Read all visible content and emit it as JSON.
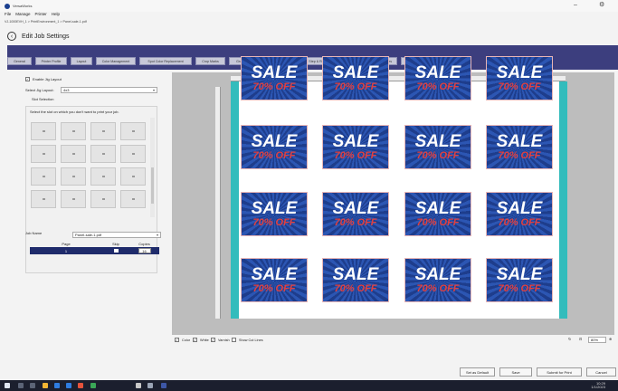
{
  "window": {
    "title": "VersaWorks",
    "min_glyph": "–",
    "settings_glyph": "⚙"
  },
  "menu": [
    "File",
    "Manage",
    "Printer",
    "Help"
  ],
  "breadcrumb": "VJ-1000EVH_1 > PrintEnvironment_1 > Panel-sale-1.pdf",
  "header": {
    "back_glyph": "‹",
    "title": "Edit Job Settings"
  },
  "tabs": [
    {
      "label": "General",
      "active": false
    },
    {
      "label": "Printer Profile",
      "active": false
    },
    {
      "label": "Layout",
      "active": false
    },
    {
      "label": "Color Management",
      "active": false
    },
    {
      "label": "Spot Color Replacement",
      "active": false
    },
    {
      "label": "Crop Marks",
      "active": false
    },
    {
      "label": "Grommets",
      "active": false
    },
    {
      "label": "Tiling & Clipping",
      "active": false
    },
    {
      "label": "Step & Repeat",
      "active": false
    },
    {
      "label": "Jig Layout",
      "active": true
    },
    {
      "label": "Print Modes",
      "active": false
    },
    {
      "label": "Summary",
      "active": false
    }
  ],
  "jig": {
    "enable_label": "Enable Jig Layout",
    "enabled": true,
    "select_label": "Select Jig Layout:",
    "select_value": "4x3",
    "slot_heading": "Slot Selection",
    "slot_help": "Select the slot on which you don't want to print your job.",
    "slot_rows": 4,
    "slot_cols": 4,
    "legend_unavailable": "Unavailable Slots",
    "legend_available": "Available Slots",
    "colors": {
      "unavailable": "#d93025",
      "available": "#bfbfbf"
    }
  },
  "job": {
    "name_label": "Job Name",
    "name_value": "Panel-sale-1.pdf",
    "columns": [
      "Page",
      "Skip",
      "Copies"
    ],
    "rows": [
      {
        "page": "1",
        "skip": false,
        "copies": "16"
      }
    ]
  },
  "artwork": {
    "headline": "SALE",
    "subline": "70% OFF",
    "rows": 4,
    "cols": 4,
    "colors": {
      "background": "#1e3d8c",
      "headline": "#ffffff",
      "subline": "#e2403f",
      "jig_edge": "#33bcbc"
    }
  },
  "options": {
    "color": "Color",
    "white": "White",
    "varnish": "Varnish",
    "cut_lines": "Show Cut Lines"
  },
  "zoom": {
    "value": "80%",
    "refresh_glyph": "↻",
    "fit_glyph": "⊡",
    "zoom_glyph": "⊕"
  },
  "buttons": {
    "set_default": "Set as Default",
    "save": "Save",
    "submit": "Submit for Print",
    "cancel": "Cancel"
  },
  "taskbar": {
    "time": "10:29",
    "date": "1/1/2023"
  },
  "accent": "#3c3e7e"
}
